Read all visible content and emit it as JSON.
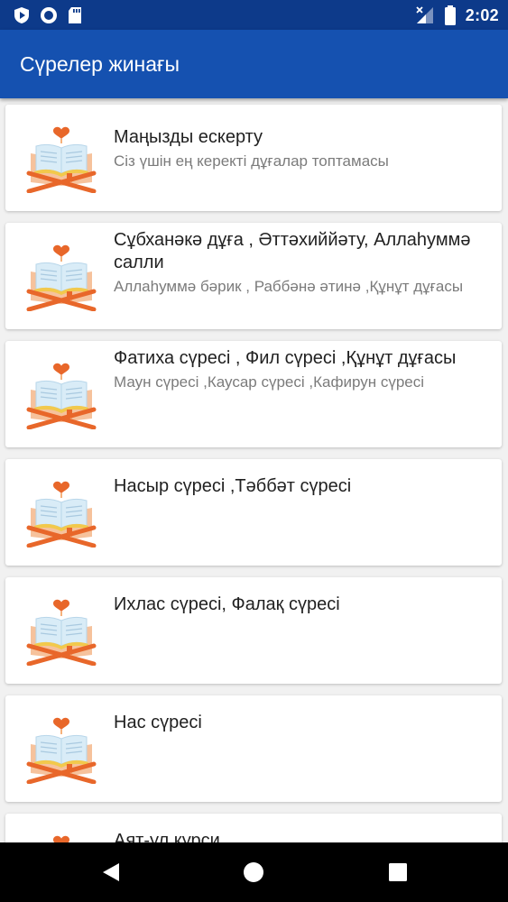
{
  "status_bar": {
    "time": "2:02",
    "left_icons": [
      "play-shield-icon",
      "circle-icon",
      "sd-card-icon"
    ],
    "right_icons": [
      "signal-off-icon",
      "battery-icon"
    ]
  },
  "app_bar": {
    "title": "Сүрелер жинағы"
  },
  "items": [
    {
      "title": "Маңызды ескерту",
      "subtitle": "Сіз үшін ең керекті дұғалар топтамасы",
      "icon": "quran-book-icon"
    },
    {
      "title": "Сұбханəкə дұға , Əттəхиййəту, Аллаһуммə салли",
      "subtitle": "Аллаһуммə бəрик , Раббəнə əтинə ,Құнұт дұғасы",
      "icon": "quran-book-icon"
    },
    {
      "title": "Фатиха сүресі , Фил сүресі ,Құнұт дұғасы",
      "subtitle": "Маун сүресі ,Каусар сүресі ,Кафирун сүресі",
      "icon": "quran-book-icon"
    },
    {
      "title": "Насыр сүресі ,Тəббəт сүресі",
      "subtitle": "",
      "icon": "quran-book-icon"
    },
    {
      "title": "Ихлас сүресі, Фалақ сүресі",
      "subtitle": "",
      "icon": "quran-book-icon"
    },
    {
      "title": "Нас сүресі",
      "subtitle": "",
      "icon": "quran-book-icon"
    },
    {
      "title": "Аят-ул курси",
      "subtitle": "",
      "icon": "quran-book-icon"
    }
  ],
  "nav_bar": {
    "buttons": [
      "back-icon",
      "home-icon",
      "recents-icon"
    ]
  },
  "colors": {
    "status_bar": "#0d3a8a",
    "app_bar": "#1551b0",
    "background": "#f1f1f1",
    "title_text": "#212121",
    "subtitle_text": "#7b7b7b",
    "icon_orange": "#e8672a",
    "icon_peach": "#f6c29c",
    "icon_book": "#d9ecf7",
    "icon_heart": "#e8672a"
  }
}
